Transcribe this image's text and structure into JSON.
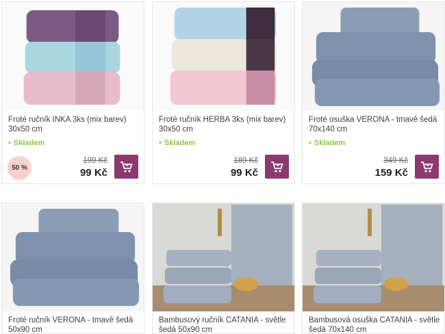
{
  "products": [
    {
      "title": "Froté ručník INKA 3ks (mix barev) 30x50 cm",
      "stock": "Skladem",
      "old_price": "199 Kč",
      "price": "99 Kč",
      "badge": "50 %",
      "cart_icon": "cart-icon"
    },
    {
      "title": "Froté ručník HERBA 3ks (mix barev) 30x50 cm",
      "stock": "Skladem",
      "old_price": "189 Kč",
      "price": "99 Kč",
      "cart_icon": "cart-icon"
    },
    {
      "title": "Froté osuška VERONA - tmavě šedá 70x140 cm",
      "stock": "Skladem",
      "old_price": "349 Kč",
      "price": "159 Kč",
      "cart_icon": "cart-icon"
    },
    {
      "title": "Froté ručník VERONA - tmavě šedá 50x90 cm"
    },
    {
      "title": "Bambusový ručník CATANIA - světle šedá 50x90 cm"
    },
    {
      "title": "Bambusová osuška CATANIA - světle šedá 70x140 cm"
    }
  ],
  "colors": {
    "accent": "#8b3a6f",
    "stock_green": "#8cc63f",
    "badge_bg": "#f6d2ce"
  }
}
